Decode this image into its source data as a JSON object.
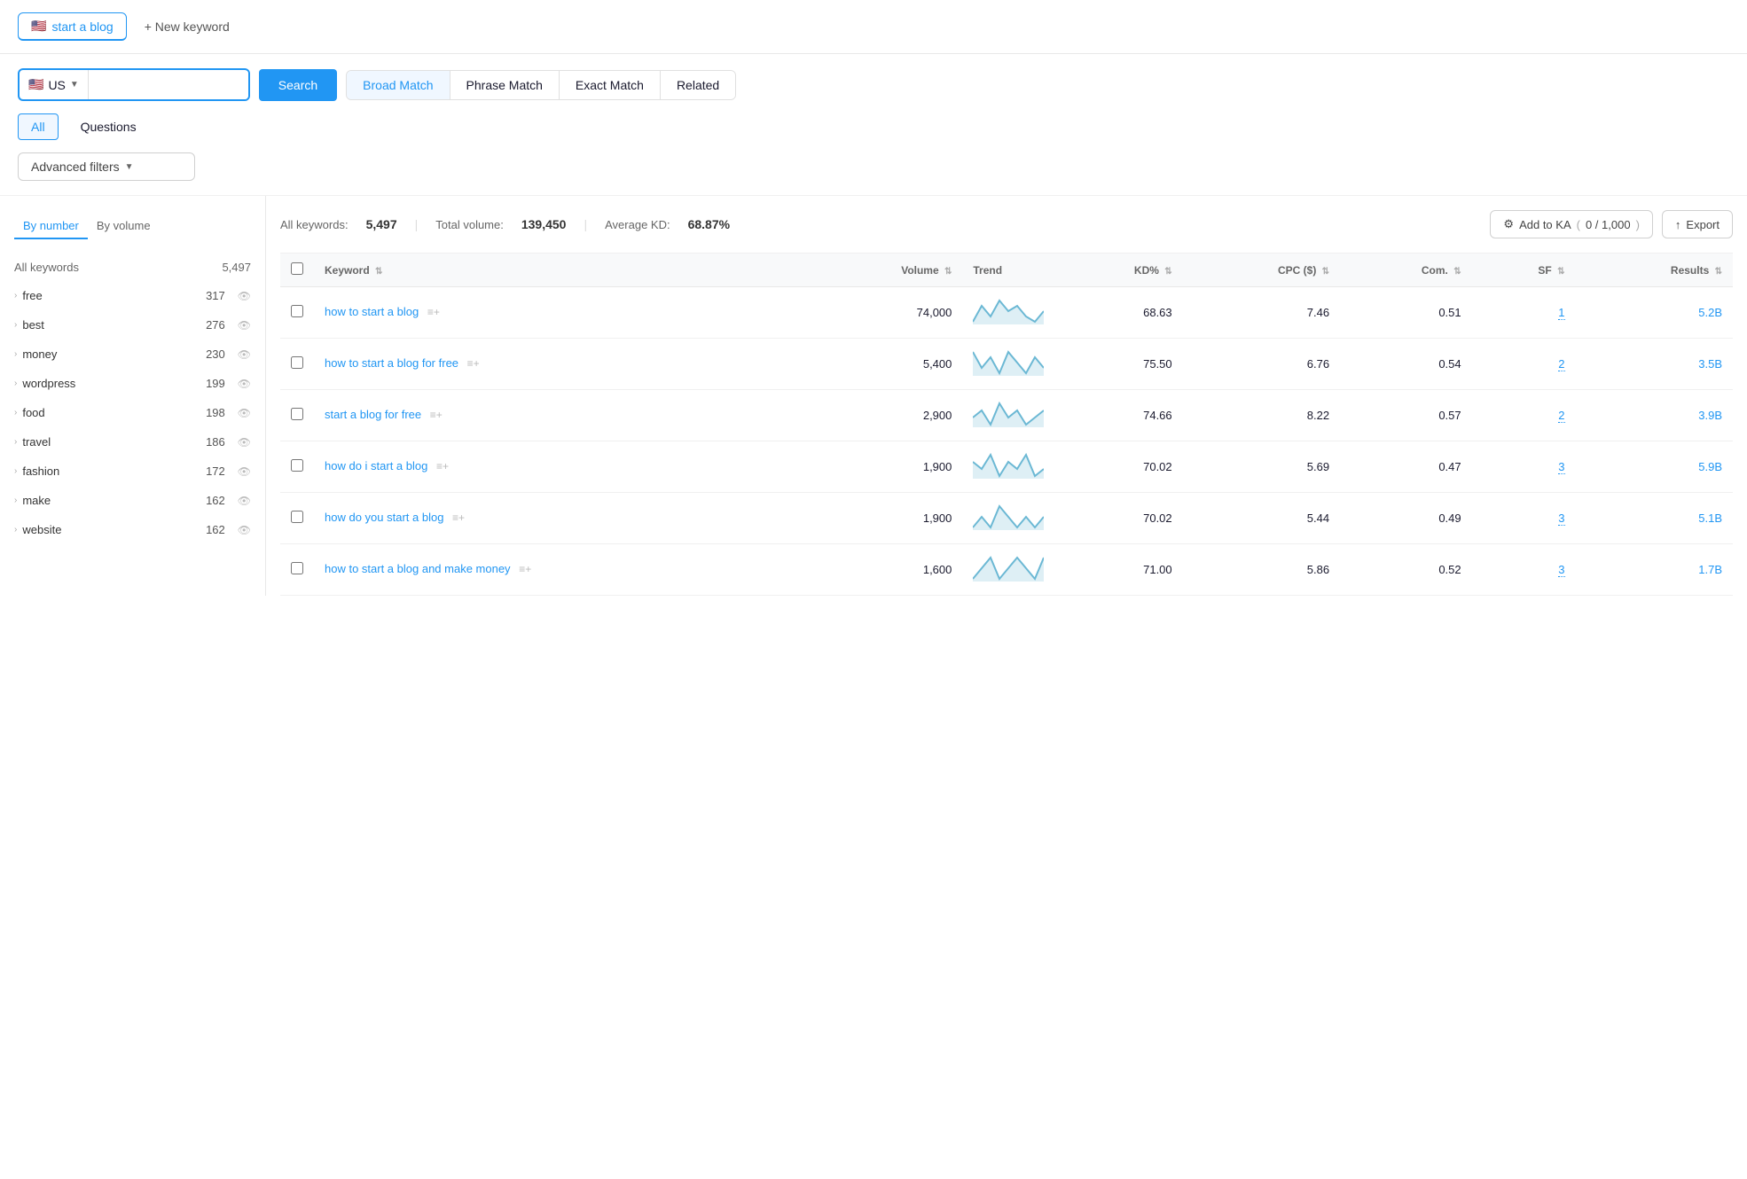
{
  "tabs": [
    {
      "id": "start-a-blog",
      "label": "start a blog",
      "flag": "🇺🇸",
      "active": true
    },
    {
      "id": "new-keyword",
      "label": "+ New keyword"
    }
  ],
  "search": {
    "country_flag": "🇺🇸",
    "country_code": "US",
    "search_label": "Search",
    "input_value": "",
    "input_placeholder": ""
  },
  "match_tabs": [
    {
      "id": "broad",
      "label": "Broad Match",
      "active": true
    },
    {
      "id": "phrase",
      "label": "Phrase Match"
    },
    {
      "id": "exact",
      "label": "Exact Match"
    },
    {
      "id": "related",
      "label": "Related"
    }
  ],
  "filter_tabs": [
    {
      "id": "all",
      "label": "All",
      "active": true
    },
    {
      "id": "questions",
      "label": "Questions"
    }
  ],
  "advanced_filters_label": "Advanced filters",
  "sidebar": {
    "tabs": [
      {
        "id": "by-number",
        "label": "By number",
        "active": true
      },
      {
        "id": "by-volume",
        "label": "By volume"
      }
    ],
    "header": {
      "col1": "All keywords",
      "col2": "5,497"
    },
    "items": [
      {
        "label": "free",
        "count": "317"
      },
      {
        "label": "best",
        "count": "276"
      },
      {
        "label": "money",
        "count": "230"
      },
      {
        "label": "wordpress",
        "count": "199"
      },
      {
        "label": "food",
        "count": "198"
      },
      {
        "label": "travel",
        "count": "186"
      },
      {
        "label": "fashion",
        "count": "172"
      },
      {
        "label": "make",
        "count": "162"
      },
      {
        "label": "website",
        "count": "162"
      }
    ]
  },
  "table": {
    "stats": {
      "all_keywords_label": "All keywords:",
      "all_keywords_value": "5,497",
      "total_volume_label": "Total volume:",
      "total_volume_value": "139,450",
      "avg_kd_label": "Average KD:",
      "avg_kd_value": "68.87%"
    },
    "actions": {
      "add_to_ka_label": "Add to KA",
      "add_to_ka_count": "0 / 1,000",
      "export_label": "Export"
    },
    "columns": [
      {
        "id": "keyword",
        "label": "Keyword"
      },
      {
        "id": "volume",
        "label": "Volume"
      },
      {
        "id": "trend",
        "label": "Trend"
      },
      {
        "id": "kd",
        "label": "KD%"
      },
      {
        "id": "cpc",
        "label": "CPC ($)"
      },
      {
        "id": "com",
        "label": "Com."
      },
      {
        "id": "sf",
        "label": "SF"
      },
      {
        "id": "results",
        "label": "Results"
      }
    ],
    "rows": [
      {
        "keyword": "how to start a blog",
        "volume": "74,000",
        "kd": "68.63",
        "cpc": "7.46",
        "com": "0.51",
        "sf": "1",
        "results": "5.2B",
        "trend_points": "5,8,6,9,7,8,6,5,7"
      },
      {
        "keyword": "how to start a blog for free",
        "volume": "5,400",
        "kd": "75.50",
        "cpc": "6.76",
        "com": "0.54",
        "sf": "2",
        "results": "3.5B",
        "trend_points": "8,5,7,4,8,6,4,7,5"
      },
      {
        "keyword": "start a blog for free",
        "volume": "2,900",
        "kd": "74.66",
        "cpc": "8.22",
        "com": "0.57",
        "sf": "2",
        "results": "3.9B",
        "trend_points": "6,7,5,8,6,7,5,6,7"
      },
      {
        "keyword": "how do i start a blog",
        "volume": "1,900",
        "kd": "70.02",
        "cpc": "5.69",
        "com": "0.47",
        "sf": "3",
        "results": "5.9B",
        "trend_points": "7,6,8,5,7,6,8,5,6"
      },
      {
        "keyword": "how do you start a blog",
        "volume": "1,900",
        "kd": "70.02",
        "cpc": "5.44",
        "com": "0.49",
        "sf": "3",
        "results": "5.1B",
        "trend_points": "5,6,5,7,6,5,6,5,6"
      },
      {
        "keyword": "how to start a blog and make money",
        "volume": "1,600",
        "kd": "71.00",
        "cpc": "5.86",
        "com": "0.52",
        "sf": "3",
        "results": "1.7B",
        "trend_points": "6,7,8,6,7,8,7,6,8"
      }
    ]
  }
}
